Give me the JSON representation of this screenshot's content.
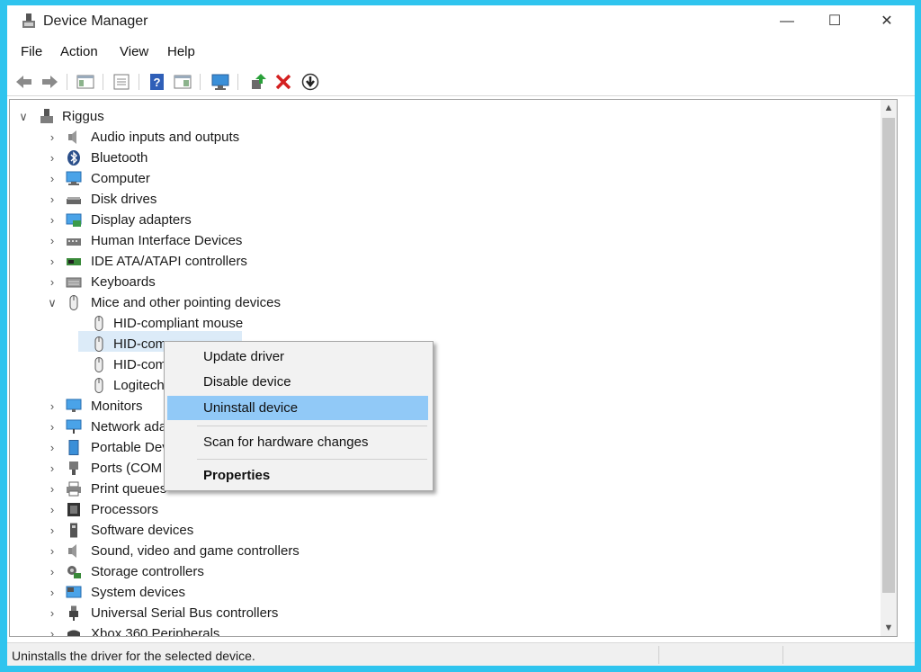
{
  "window": {
    "title": "Device Manager",
    "controls": {
      "minimize": "—",
      "maximize": "☐",
      "close": "✕"
    }
  },
  "menu": [
    "File",
    "Action",
    "View",
    "Help"
  ],
  "toolbar": [
    "back-icon",
    "forward-icon",
    "show-hide-console-tree-icon",
    "properties-icon",
    "help-icon",
    "show-action-pane-icon",
    "scan-hardware-icon",
    "update-driver-icon",
    "uninstall-icon",
    "disable-device-icon"
  ],
  "tree": {
    "root": "Riggus",
    "categories": [
      {
        "label": "Audio inputs and outputs",
        "icon": "speaker-icon"
      },
      {
        "label": "Bluetooth",
        "icon": "bluetooth-icon"
      },
      {
        "label": "Computer",
        "icon": "computer-icon"
      },
      {
        "label": "Disk drives",
        "icon": "disk-drive-icon"
      },
      {
        "label": "Display adapters",
        "icon": "display-adapter-icon"
      },
      {
        "label": "Human Interface Devices",
        "icon": "hid-icon"
      },
      {
        "label": "IDE ATA/ATAPI controllers",
        "icon": "ide-controller-icon"
      },
      {
        "label": "Keyboards",
        "icon": "keyboard-icon"
      },
      {
        "label": "Mice and other pointing devices",
        "icon": "mouse-icon",
        "expanded": true
      },
      {
        "label": "Monitors",
        "icon": "monitor-icon"
      },
      {
        "label": "Network ada",
        "icon": "network-adapter-icon"
      },
      {
        "label": "Portable Dev",
        "icon": "portable-device-icon"
      },
      {
        "label": "Ports (COM &",
        "icon": "port-icon"
      },
      {
        "label": "Print queues",
        "icon": "printer-icon"
      },
      {
        "label": "Processors",
        "icon": "processor-icon"
      },
      {
        "label": "Software devices",
        "icon": "software-device-icon"
      },
      {
        "label": "Sound, video and game controllers",
        "icon": "sound-controller-icon"
      },
      {
        "label": "Storage controllers",
        "icon": "storage-controller-icon"
      },
      {
        "label": "System devices",
        "icon": "system-device-icon"
      },
      {
        "label": "Universal Serial Bus controllers",
        "icon": "usb-icon"
      },
      {
        "label": "Xbox 360 Peripherals",
        "icon": "xbox-icon"
      }
    ],
    "mice_children": [
      "HID-compliant mouse",
      "HID-com",
      "HID-com",
      "Logitech"
    ],
    "selected_index": 1
  },
  "context_menu": {
    "items": [
      "Update driver",
      "Disable device",
      "Uninstall device",
      "Scan for hardware changes",
      "Properties"
    ],
    "highlighted": "Uninstall device",
    "bold": "Properties"
  },
  "status_bar": {
    "text": "Uninstalls the driver for the selected device."
  }
}
